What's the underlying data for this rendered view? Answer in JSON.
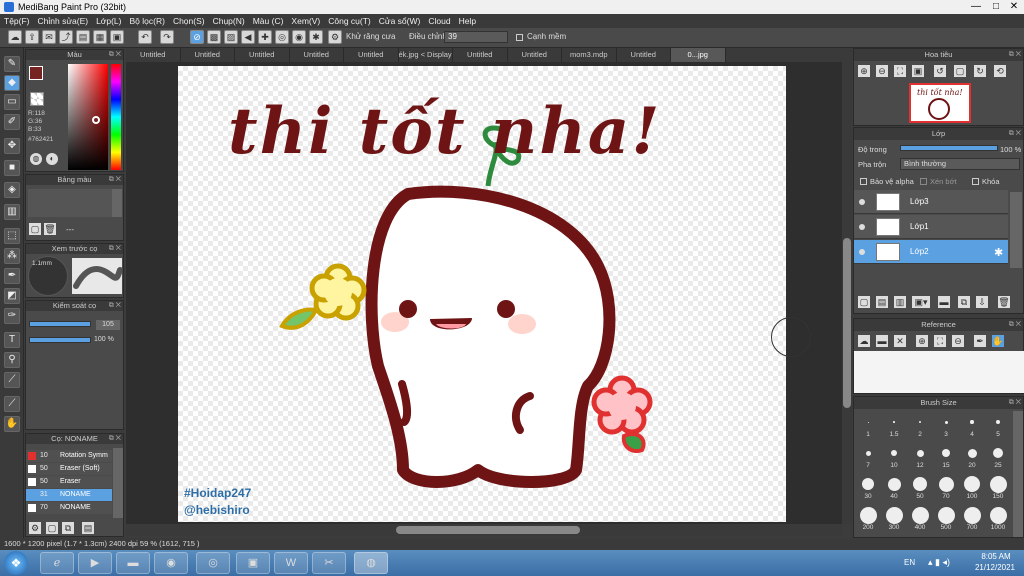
{
  "window": {
    "title": "MediBang Paint Pro (32bit)",
    "minimize": "—",
    "maximize": "□",
    "close": "✕"
  },
  "menu": [
    "Tệp(F)",
    "Chỉnh sửa(E)",
    "Lớp(L)",
    "Bộ lọc(R)",
    "Chọn(S)",
    "Chụp(N)",
    "Màu (C)",
    "Xem(V)",
    "Công cụ(T)",
    "Cửa sổ(W)",
    "Cloud",
    "Help"
  ],
  "toolbar": {
    "antialias_label": "Khử răng cưa",
    "adjust_label": "Điều chỉnh",
    "adjust_value": "39",
    "soft_edge_label": "Cạnh mềm"
  },
  "color_panel": {
    "title": "Màu",
    "r": "R:118",
    "g": "G:36",
    "b": "B:33",
    "hex": "#762421",
    "fg_color": "#762421",
    "bg_color": "#0a7a3a"
  },
  "palette_panel": {
    "title": "Bảng màu",
    "dash": "---"
  },
  "brush_preview_panel": {
    "title": "Xem trước cọ",
    "size": "1.1mm"
  },
  "brush_control_panel": {
    "title": "Kiểm soát cọ",
    "size_value": "105",
    "opacity_value": "100 %"
  },
  "brush_list_panel": {
    "title": "Cọ: NONAME",
    "items": [
      {
        "size": "10",
        "name": "Rotation Symm",
        "color": "#e03030"
      },
      {
        "size": "50",
        "name": "Eraser (Soft)",
        "color": "#ffffff"
      },
      {
        "size": "50",
        "name": "Eraser",
        "color": "#ffffff"
      },
      {
        "size": "31",
        "name": "NONAME",
        "color": "#5ba0e0"
      },
      {
        "size": "70",
        "name": "NONAME",
        "color": "#ffffff"
      }
    ]
  },
  "tabs": [
    "Untitled",
    "Untitled",
    "Untitled",
    "Untitled",
    "Untitled",
    "ék.jpg < Display P3 >",
    "Untitled",
    "Untitled",
    "mom3.mdp",
    "Untitled",
    "0...jpg"
  ],
  "canvas_text": {
    "line1": "thi tốt nha!",
    "watermark1": "#Hoidap247",
    "watermark2": "@hebishiro"
  },
  "navigator_panel": {
    "title": "Hoa tiêu"
  },
  "layer_panel": {
    "title": "Lớp",
    "opacity_label": "Độ trong",
    "opacity_value": "100 %",
    "blend_label": "Pha trộn",
    "blend_value": "Bình thường",
    "protect_alpha": "Bảo vệ alpha",
    "clipping": "Xén bớt",
    "lock": "Khóa",
    "layers": [
      "Lớp3",
      "Lớp1",
      "Lớp2"
    ]
  },
  "reference_panel": {
    "title": "Reference"
  },
  "brush_size_panel": {
    "title": "Brush Size",
    "sizes": [
      "1",
      "1.5",
      "2",
      "3",
      "4",
      "5",
      "7",
      "10",
      "12",
      "15",
      "20",
      "25",
      "30",
      "40",
      "50",
      "70",
      "100",
      "150",
      "200",
      "300",
      "400",
      "500",
      "700",
      "1000"
    ]
  },
  "status": {
    "text": "1600 * 1200 pixel  (1.7 * 1.3cm)  2400 dpi  59 %  (1612, 715 )"
  },
  "taskbar": {
    "lang": "EN",
    "time": "8:05 AM",
    "date": "21/12/2021"
  },
  "icons": [
    "brush-icon",
    "eraser-icon",
    "select-rect-icon",
    "pen-icon",
    "move-icon",
    "fill-icon",
    "bucket-icon",
    "gradient-icon",
    "lasso-icon",
    "magic-wand-icon",
    "text-icon",
    "eyedropper-icon",
    "hand-icon"
  ]
}
